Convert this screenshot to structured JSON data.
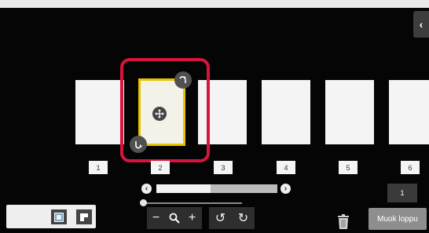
{
  "header": {
    "collapse_icon": "chevron-left-icon",
    "collapse_glyph": "‹"
  },
  "pages": [
    {
      "number": "1",
      "selected": false
    },
    {
      "number": "2",
      "selected": true
    },
    {
      "number": "3",
      "selected": false
    },
    {
      "number": "4",
      "selected": false
    },
    {
      "number": "5",
      "selected": false
    },
    {
      "number": "6",
      "selected": false
    }
  ],
  "selection": {
    "move_icon": "move-icon",
    "rotate_cw_icon": "rotate-clockwise-icon",
    "rotate_ccw_icon": "rotate-counterclockwise-icon",
    "accent_color": "#d7143c",
    "page_border_color": "#e7c300"
  },
  "scrollbar": {
    "left_arrow": "‹",
    "right_arrow": "›",
    "visible_fraction": 0.45
  },
  "zoom_slider": {
    "level_fraction": 0.0
  },
  "toolbar": {
    "zoom_out": "−",
    "search": "⌕",
    "zoom_in": "+",
    "undo": "↺",
    "redo": "↻"
  },
  "view_toggle": {
    "items": [
      "thumbnail-view-icon",
      "single-page-view-icon"
    ]
  },
  "page_counter": "1",
  "delete_icon": "trash-icon",
  "finish_button": "Muok loppu"
}
